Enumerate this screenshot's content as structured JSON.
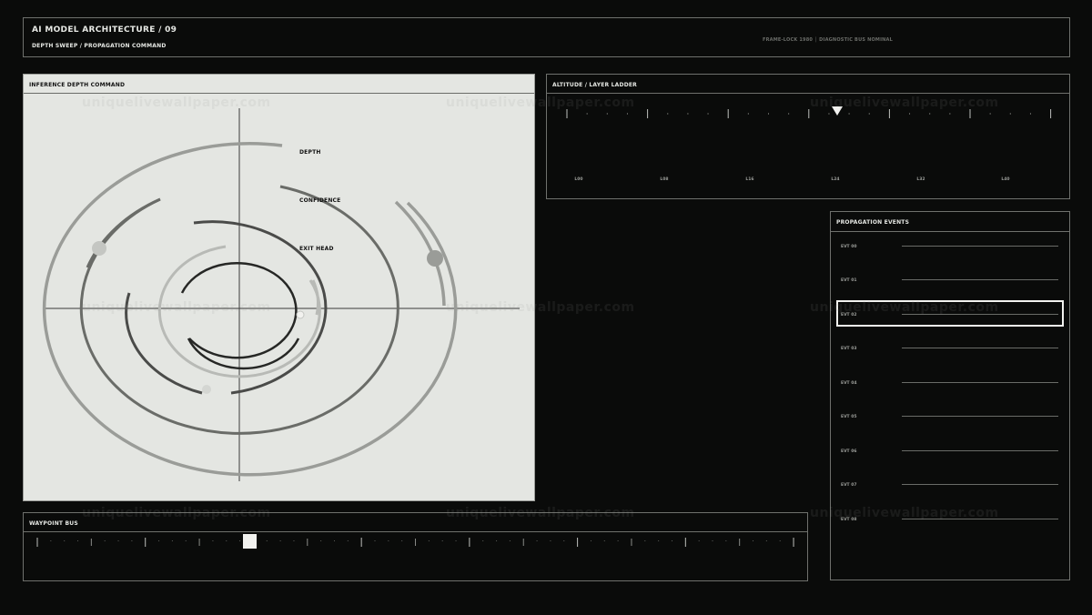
{
  "header": {
    "title": "AI MODEL ARCHITECTURE / 09",
    "subtitle": "DEPTH SWEEP / PROPAGATION COMMAND",
    "status": "FRAME-LOCK 1980 │ DIAGNOSTIC BUS NOMINAL"
  },
  "depth_panel": {
    "title": "INFERENCE DEPTH COMMAND",
    "labels": {
      "depth": "DEPTH",
      "confidence": "CONFIDENCE",
      "exit_head": "EXIT HEAD"
    }
  },
  "ladder_panel": {
    "title": "ALTITUDE / LAYER LADDER",
    "tick_labels": [
      "L00",
      "L08",
      "L16",
      "L24",
      "L32",
      "L40"
    ]
  },
  "events_panel": {
    "title": "PROPAGATION EVENTS",
    "events": [
      "EVT 00",
      "EVT 01",
      "EVT 02",
      "EVT 03",
      "EVT 04",
      "EVT 05",
      "EVT 06",
      "EVT 07",
      "EVT 08"
    ],
    "selected_index": 2
  },
  "bus_panel": {
    "title": "WAYPOINT BUS"
  },
  "watermark": "uniquelivewallpaper.com",
  "colors": {
    "background": "#0a0b0a",
    "panel_light": "#e4e6e2",
    "border": "#6f716d",
    "highlight": "#f2f2ef"
  }
}
